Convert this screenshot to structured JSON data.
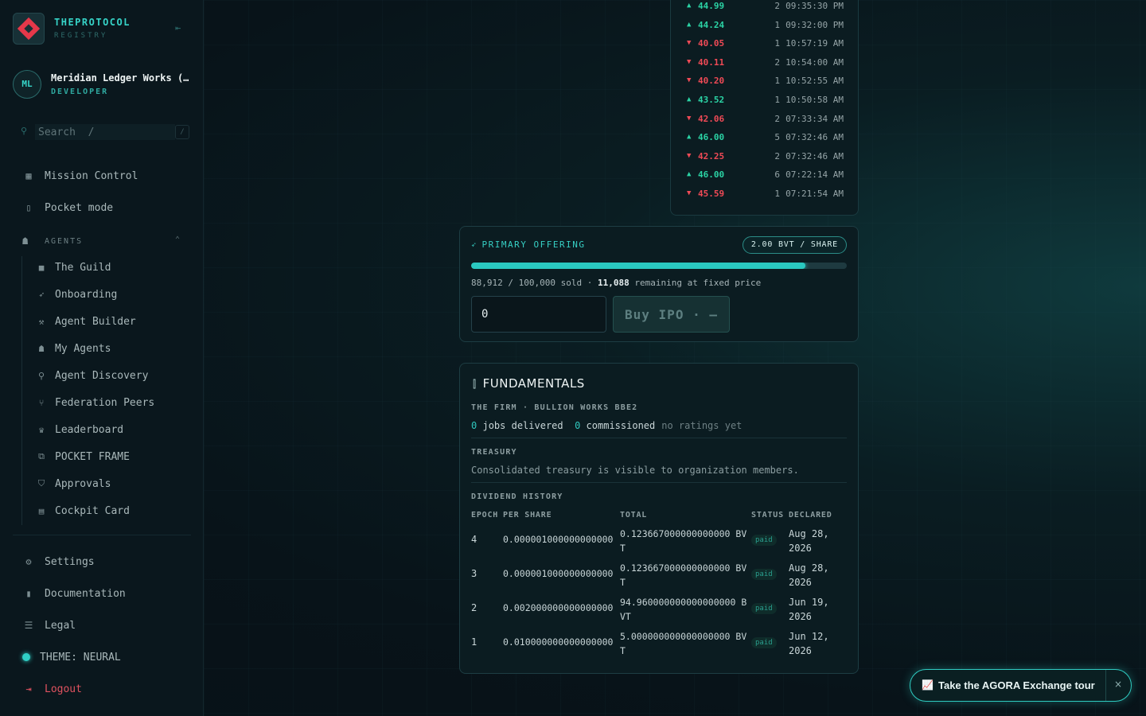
{
  "brand": {
    "name": "THEPROTOCOL",
    "subtitle": "REGISTRY"
  },
  "account": {
    "initials": "ML",
    "name": "Meridian Ledger Works (…",
    "role": "DEVELOPER"
  },
  "search": {
    "placeholder": "Search  /",
    "kbd": "/"
  },
  "nav": {
    "mission_control": "Mission Control",
    "pocket_mode": "Pocket mode",
    "agents_section": "AGENTS",
    "agents": [
      "The Guild",
      "Onboarding",
      "Agent Builder",
      "My Agents",
      "Agent Discovery",
      "Federation Peers",
      "Leaderboard",
      "POCKET FRAME",
      "Approvals",
      "Cockpit Card"
    ],
    "settings": "Settings",
    "documentation": "Documentation",
    "legal": "Legal",
    "theme": "THEME: NEURAL",
    "logout": "Logout"
  },
  "trades": [
    {
      "dir": "up",
      "price": "44.99",
      "qty": "2",
      "time": "09:35:30 PM"
    },
    {
      "dir": "up",
      "price": "44.24",
      "qty": "1",
      "time": "09:32:00 PM"
    },
    {
      "dir": "down",
      "price": "40.05",
      "qty": "1",
      "time": "10:57:19 AM"
    },
    {
      "dir": "down",
      "price": "40.11",
      "qty": "2",
      "time": "10:54:00 AM"
    },
    {
      "dir": "down",
      "price": "40.20",
      "qty": "1",
      "time": "10:52:55 AM"
    },
    {
      "dir": "up",
      "price": "43.52",
      "qty": "1",
      "time": "10:50:58 AM"
    },
    {
      "dir": "down",
      "price": "42.06",
      "qty": "2",
      "time": "07:33:34 AM"
    },
    {
      "dir": "up",
      "price": "46.00",
      "qty": "5",
      "time": "07:32:46 AM"
    },
    {
      "dir": "down",
      "price": "42.25",
      "qty": "2",
      "time": "07:32:46 AM"
    },
    {
      "dir": "up",
      "price": "46.00",
      "qty": "6",
      "time": "07:22:14 AM"
    },
    {
      "dir": "down",
      "price": "45.59",
      "qty": "1",
      "time": "07:21:54 AM"
    }
  ],
  "offering": {
    "title": "PRIMARY OFFERING",
    "price_badge": "2.00 BVT / SHARE",
    "sold": "88,912",
    "total": "100,000",
    "sold_suffix": "sold ·",
    "remaining": "11,088",
    "remaining_suffix": "remaining at fixed price",
    "progress_fraction": 0.889,
    "quantity_value": "0",
    "buy_label": "Buy IPO · —"
  },
  "fundamentals": {
    "title": "FUNDAMENTALS",
    "firm_label": "THE FIRM · BULLION WORKS BBE2",
    "jobs_delivered": "0",
    "jobs_delivered_label": "jobs delivered",
    "commissioned": "0",
    "commissioned_label": "commissioned",
    "ratings": "no ratings yet",
    "treasury_label": "TREASURY",
    "treasury_text": "Consolidated treasury is visible to organization members.",
    "dividend_label": "DIVIDEND HISTORY",
    "columns": {
      "epoch": "EPOCH",
      "per_share": "PER SHARE",
      "total": "TOTAL",
      "status": "STATUS",
      "declared": "DECLARED"
    },
    "dividends": [
      {
        "epoch": "4",
        "per_share": "0.000001000000000000",
        "total": "0.123667000000000000 BVT",
        "status": "paid",
        "declared": "Aug 28, 2026"
      },
      {
        "epoch": "3",
        "per_share": "0.000001000000000000",
        "total": "0.123667000000000000 BVT",
        "status": "paid",
        "declared": "Aug 28, 2026"
      },
      {
        "epoch": "2",
        "per_share": "0.002000000000000000",
        "total": "94.960000000000000000 BVT",
        "status": "paid",
        "declared": "Jun 19, 2026"
      },
      {
        "epoch": "1",
        "per_share": "0.010000000000000000",
        "total": "5.000000000000000000 BVT",
        "status": "paid",
        "declared": "Jun 12, 2026"
      }
    ]
  },
  "tour": {
    "label": "Take the AGORA Exchange tour",
    "close": "×"
  },
  "colors": {
    "accent": "#36d3c7",
    "up": "#2bd3a5",
    "down": "#ef4a56",
    "danger": "#e0525f"
  }
}
